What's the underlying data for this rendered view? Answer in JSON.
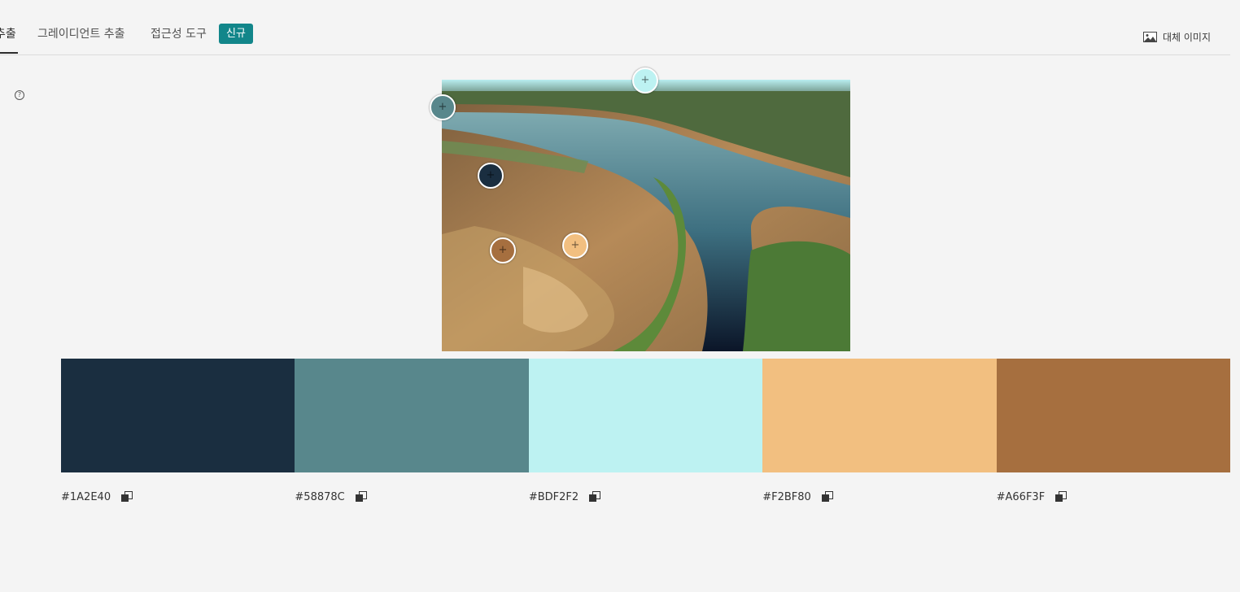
{
  "tabs": [
    {
      "label": "추출",
      "active": true
    },
    {
      "label": "그레이디언트 추출",
      "active": false
    },
    {
      "label": "접근성 도구",
      "active": false
    }
  ],
  "badge": "신규",
  "alt_image_label": "대체 이미지",
  "help_icon": "?",
  "picker_symbol": "+",
  "palette": [
    {
      "hex": "#1A2E40"
    },
    {
      "hex": "#58878C"
    },
    {
      "hex": "#BDF2F2"
    },
    {
      "hex": "#F2BF80"
    },
    {
      "hex": "#A66F3F"
    }
  ],
  "colors": {
    "accent": "#12868a",
    "background": "#f4f4f4"
  }
}
